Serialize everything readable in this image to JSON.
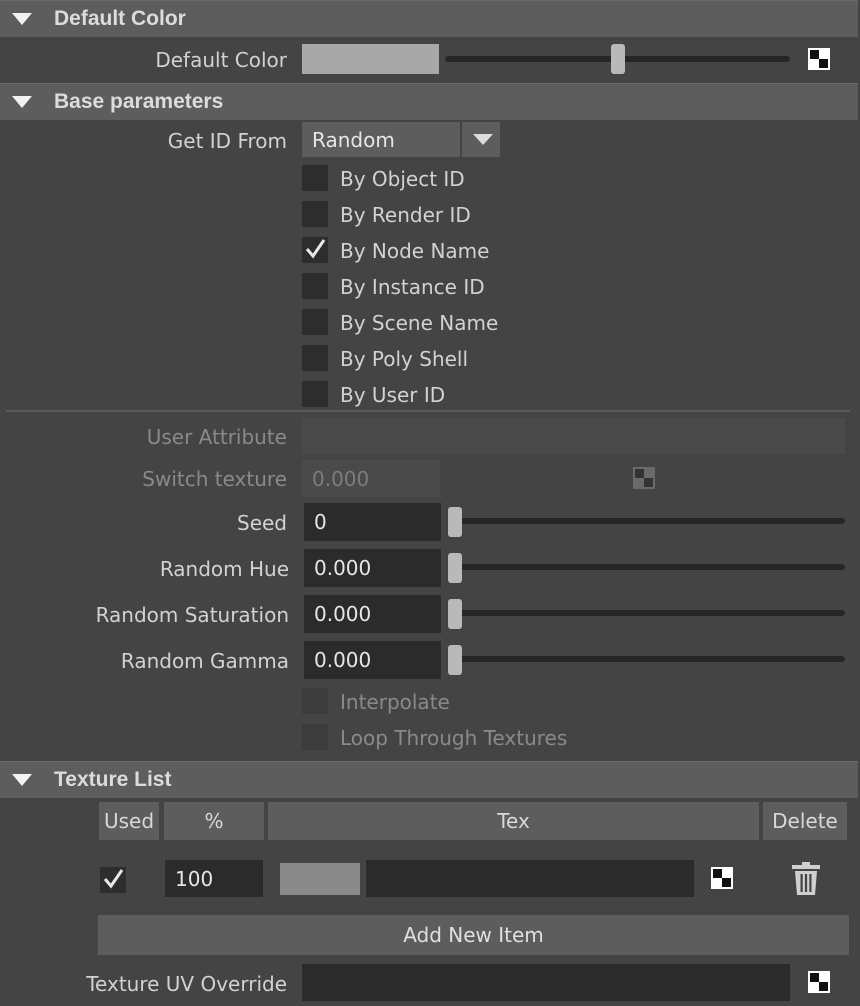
{
  "sections": {
    "default_color": {
      "title": "Default Color"
    },
    "base_parameters": {
      "title": "Base parameters"
    },
    "texture_list": {
      "title": "Texture List"
    }
  },
  "default_color": {
    "label": "Default Color",
    "swatch_color": "#a8a8a8",
    "slider_fraction": 0.5
  },
  "base": {
    "get_id_from": {
      "label": "Get ID From",
      "value": "Random"
    },
    "id_options": [
      {
        "label": "By Object ID",
        "checked": false
      },
      {
        "label": "By Render ID",
        "checked": false
      },
      {
        "label": "By Node Name",
        "checked": true
      },
      {
        "label": "By Instance ID",
        "checked": false
      },
      {
        "label": "By Scene Name",
        "checked": false
      },
      {
        "label": "By Poly Shell",
        "checked": false
      },
      {
        "label": "By User ID",
        "checked": false
      }
    ],
    "user_attribute": {
      "label": "User Attribute",
      "value": ""
    },
    "switch_texture": {
      "label": "Switch texture",
      "value": "0.000"
    },
    "seed": {
      "label": "Seed",
      "value": "0",
      "slider_fraction": 0
    },
    "random_hue": {
      "label": "Random Hue",
      "value": "0.000",
      "slider_fraction": 0
    },
    "random_saturation": {
      "label": "Random Saturation",
      "value": "0.000",
      "slider_fraction": 0
    },
    "random_gamma": {
      "label": "Random Gamma",
      "value": "0.000",
      "slider_fraction": 0
    },
    "interpolate": {
      "label": "Interpolate",
      "checked": false
    },
    "loop_through_textures": {
      "label": "Loop Through Textures",
      "checked": false
    }
  },
  "texture_list": {
    "columns": {
      "used": "Used",
      "percent": "%",
      "tex": "Tex",
      "delete": "Delete"
    },
    "rows": [
      {
        "used": true,
        "percent": "100",
        "tex_color": "#8a8a8a",
        "tex_name": ""
      }
    ],
    "add_new_item": "Add New Item",
    "uv_override": {
      "label": "Texture UV Override",
      "value": ""
    }
  },
  "icons": {
    "texture_map": "checker-icon",
    "delete": "trash-icon",
    "dropdown": "chevron-down-icon",
    "collapse": "triangle-down-icon"
  }
}
